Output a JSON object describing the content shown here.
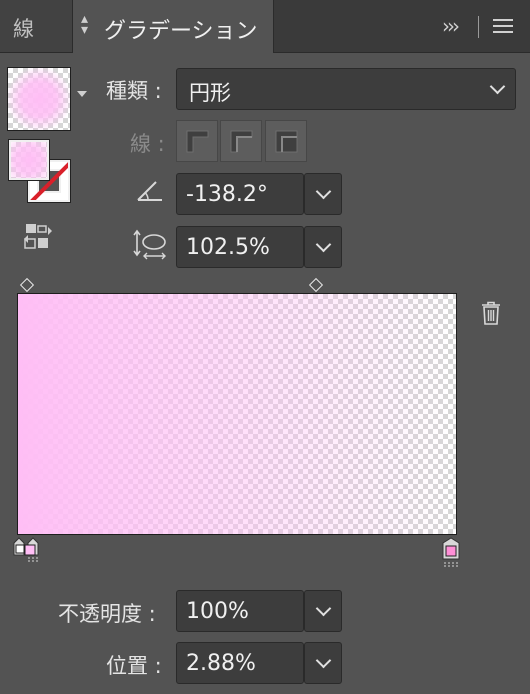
{
  "tabs": {
    "inactive": "線",
    "active": "グラデーション"
  },
  "type_label": "種類 :",
  "type_value": "円形",
  "stroke_label": "線 :",
  "angle_value": "-138.2°",
  "aspect_value": "102.5%",
  "opacity_label": "不透明度 :",
  "opacity_value": "100%",
  "position_label": "位置 :",
  "position_value": "2.88%",
  "gradient": {
    "color": "#ffbef5",
    "stops": [
      {
        "location_pct": 0,
        "opacity_pct": 100,
        "selected": true
      },
      {
        "location_pct": 100,
        "opacity_pct": 0,
        "selected": false
      }
    ],
    "midpoints_pct": [
      0,
      68
    ]
  },
  "colors": {
    "panel": "#535353",
    "field": "#3d3d3d",
    "accent_pink": "#ffbef5",
    "none_red": "#d9202a"
  },
  "icons": [
    "more-panels-icon",
    "panel-menu-icon",
    "angle-icon",
    "aspect-ratio-icon",
    "reverse-gradient-icon",
    "trash-icon",
    "chevron-down-icon"
  ]
}
